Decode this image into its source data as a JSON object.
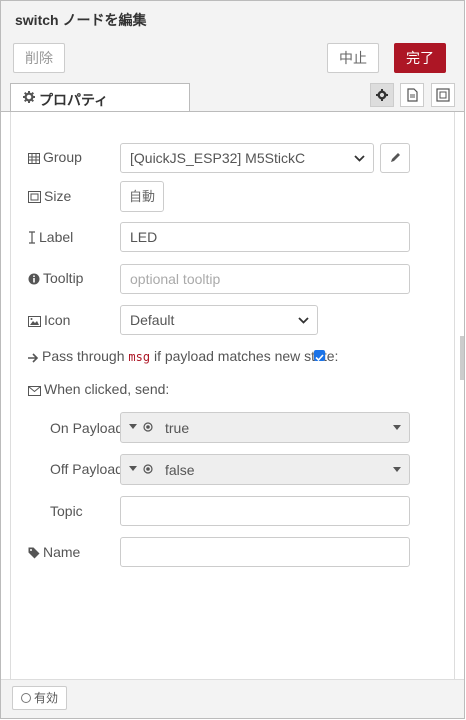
{
  "title": "switch ノードを編集",
  "toolbar": {
    "delete_label": "削除",
    "cancel_label": "中止",
    "done_label": "完了"
  },
  "tabs": {
    "properties_label": "プロパティ"
  },
  "form": {
    "group_label": "Group",
    "group_value": "[QuickJS_ESP32] M5StickC",
    "size_label": "Size",
    "size_value": "自動",
    "label_label": "Label",
    "label_value": "LED",
    "tooltip_label": "Tooltip",
    "tooltip_placeholder": "optional tooltip",
    "icon_label": "Icon",
    "icon_value": "Default",
    "passthrough_prefix": "Pass through",
    "passthrough_code": "msg",
    "passthrough_suffix": "if payload matches new state:",
    "passthrough_checked": true,
    "when_clicked_label": "When clicked, send:",
    "on_payload_label": "On Payload",
    "on_payload_value": "true",
    "off_payload_label": "Off Payload",
    "off_payload_value": "false",
    "topic_label": "Topic",
    "topic_value": "",
    "name_label": "Name",
    "name_value": ""
  },
  "footer": {
    "enabled_label": "有効"
  },
  "colors": {
    "accent": "#AD1625",
    "checkbox": "#1a73e8"
  }
}
